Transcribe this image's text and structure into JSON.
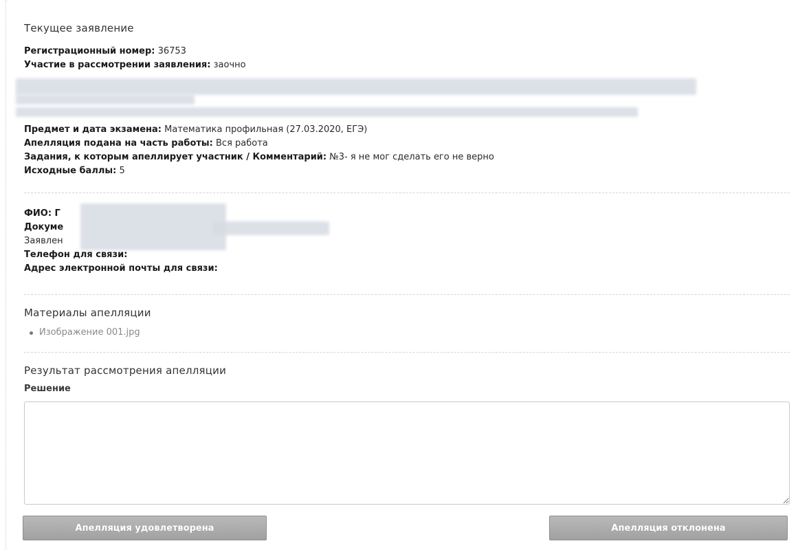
{
  "current_application": {
    "title": "Текущее заявление",
    "fields": [
      {
        "label": "Регистрационный номер:",
        "value": " 36753"
      },
      {
        "label": "Участие в рассмотрении заявления:",
        "value": " заочно"
      }
    ],
    "exam_fields": [
      {
        "label": "Предмет и дата экзамена:",
        "value": " Математика профильная (27.03.2020, ЕГЭ)"
      },
      {
        "label": "Апелляция подана на часть работы:",
        "value": " Вся работа"
      },
      {
        "label": "Задания, к которым апеллирует участник / Комментарий:",
        "value": " №3- я не мог сделать его не верно"
      },
      {
        "label": "Исходные баллы:",
        "value": " 5"
      }
    ]
  },
  "participant": {
    "fio_label": "ФИО: Г",
    "document_label": "Докуме",
    "statement_label": "Заявлен",
    "phone_label": "Телефон для связи:",
    "email_label": "Адрес электронной почты для связи:"
  },
  "materials": {
    "title": "Материалы апелляции",
    "files": [
      "Изображение 001.jpg"
    ]
  },
  "result": {
    "title": "Результат рассмотрения апелляции",
    "decision_label": "Решение",
    "decision_value": ""
  },
  "buttons": {
    "approve_label": "Апелляция удовлетворена",
    "reject_label": "Апелляция отклонена"
  },
  "colors": {
    "button_bg": "#a9a9a9",
    "redaction": "#d7dbe3"
  }
}
